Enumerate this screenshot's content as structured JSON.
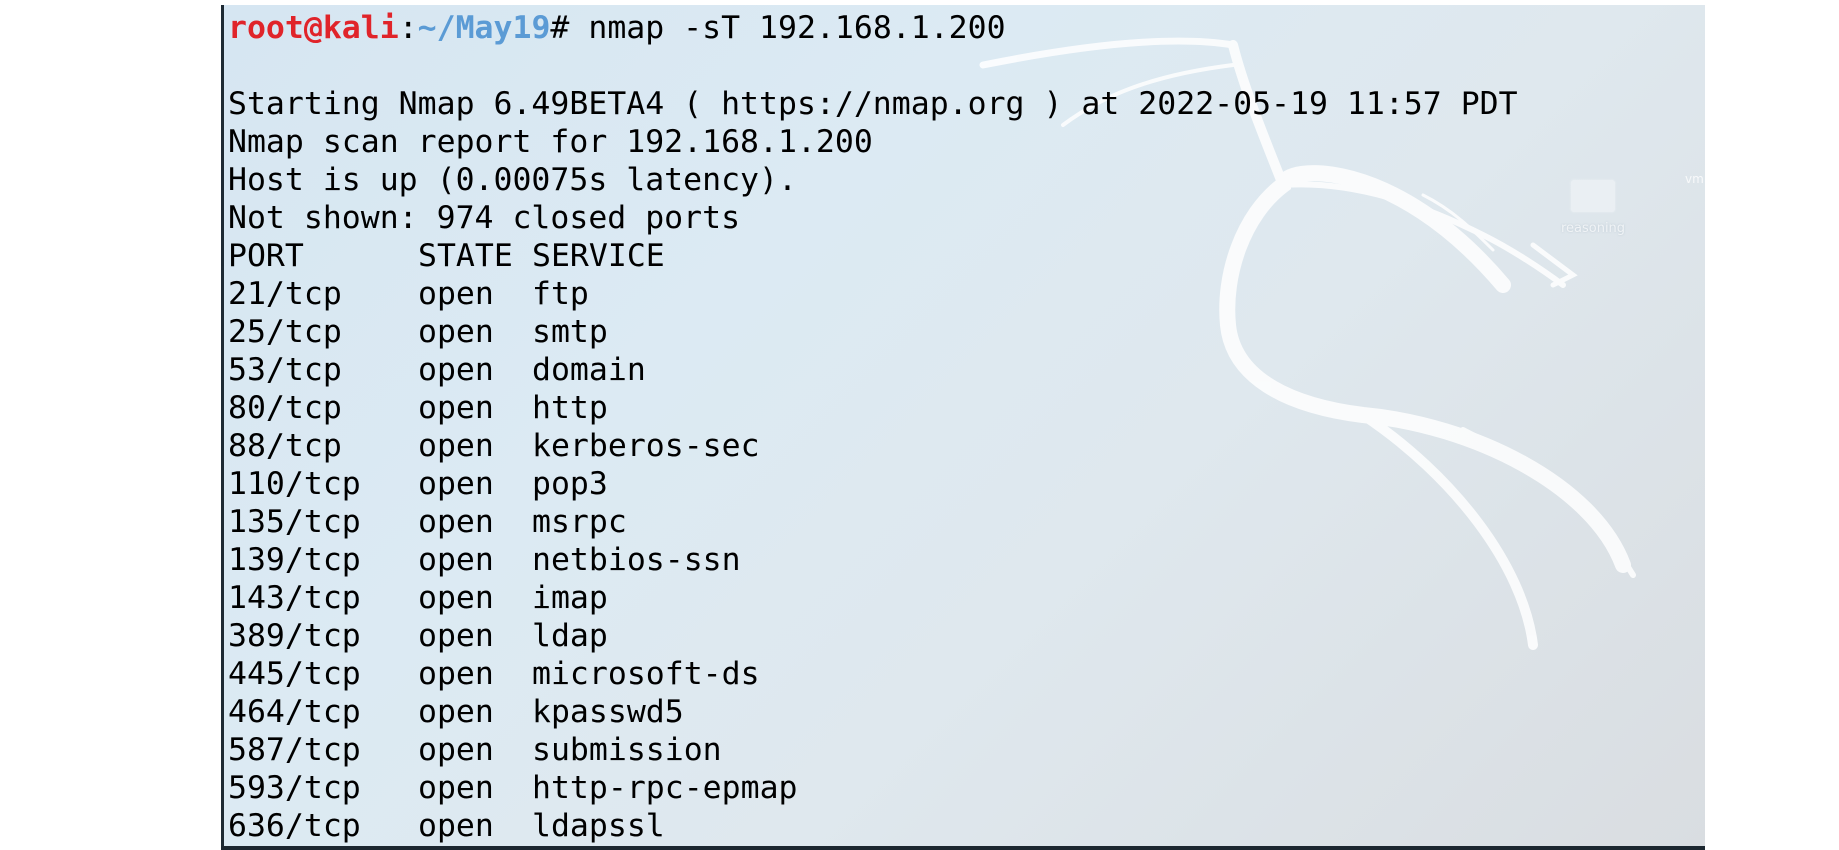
{
  "terminal": {
    "prompt": {
      "user_host": "root@kali",
      "separator": ":",
      "path": "~/May19",
      "symbol": "#",
      "command": " nmap -sT 192.168.1.200"
    },
    "output_lines": [
      "Starting Nmap 6.49BETA4 ( https://nmap.org ) at 2022-05-19 11:57 PDT",
      "Nmap scan report for 192.168.1.200",
      "Host is up (0.00075s latency).",
      "Not shown: 974 closed ports"
    ],
    "table_headers": [
      "PORT",
      "STATE",
      "SERVICE"
    ],
    "ports": [
      {
        "port": "21/tcp",
        "state": "open",
        "service": "ftp"
      },
      {
        "port": "25/tcp",
        "state": "open",
        "service": "smtp"
      },
      {
        "port": "53/tcp",
        "state": "open",
        "service": "domain"
      },
      {
        "port": "80/tcp",
        "state": "open",
        "service": "http"
      },
      {
        "port": "88/tcp",
        "state": "open",
        "service": "kerberos-sec"
      },
      {
        "port": "110/tcp",
        "state": "open",
        "service": "pop3"
      },
      {
        "port": "135/tcp",
        "state": "open",
        "service": "msrpc"
      },
      {
        "port": "139/tcp",
        "state": "open",
        "service": "netbios-ssn"
      },
      {
        "port": "143/tcp",
        "state": "open",
        "service": "imap"
      },
      {
        "port": "389/tcp",
        "state": "open",
        "service": "ldap"
      },
      {
        "port": "445/tcp",
        "state": "open",
        "service": "microsoft-ds"
      },
      {
        "port": "464/tcp",
        "state": "open",
        "service": "kpasswd5"
      },
      {
        "port": "587/tcp",
        "state": "open",
        "service": "submission"
      },
      {
        "port": "593/tcp",
        "state": "open",
        "service": "http-rpc-epmap"
      },
      {
        "port": "636/tcp",
        "state": "open",
        "service": "ldapssl"
      }
    ]
  },
  "desktop": {
    "folder_icon": "folder-icon",
    "folder_label": "reasoning",
    "vm_label": "vm"
  },
  "colors": {
    "prompt_user": "#e0242a",
    "prompt_path": "#5b9bd5",
    "text": "#000000"
  }
}
